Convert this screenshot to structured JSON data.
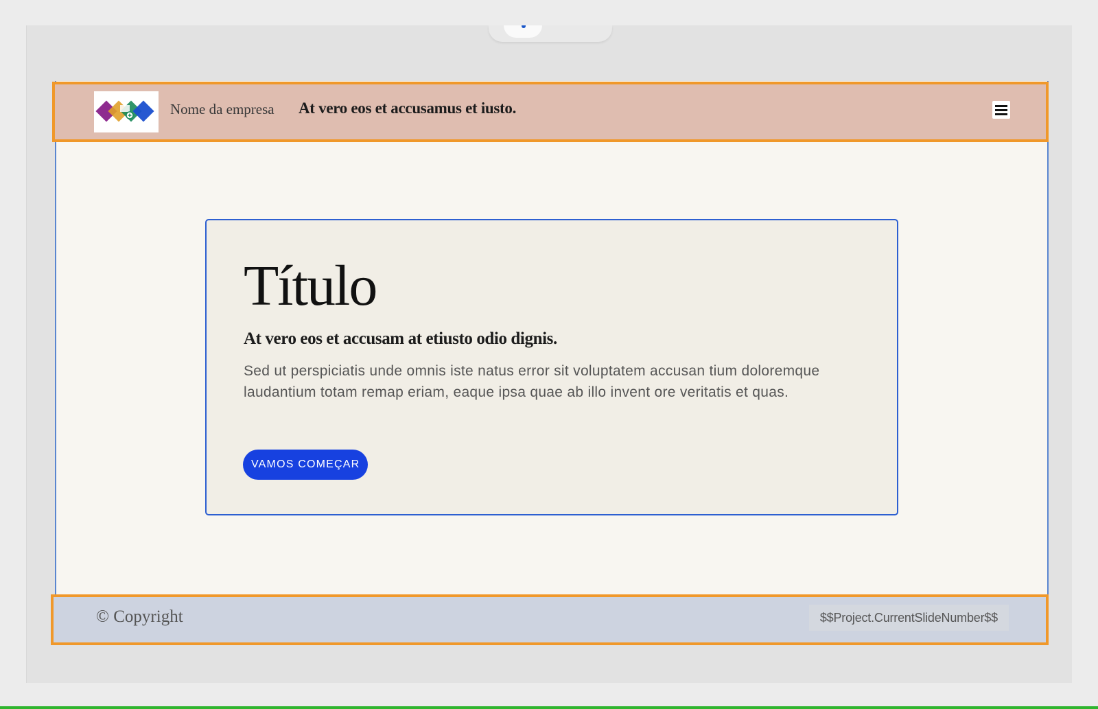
{
  "header": {
    "company_name": "Nome da empresa",
    "tagline": "At vero eos et accusamus et iusto.",
    "menu_icon": "hamburger-menu-icon"
  },
  "hero": {
    "title": "Título",
    "subtitle": "At vero eos et accusam at etiusto odio dignis.",
    "body": "Sed ut perspiciatis unde omnis iste natus error sit voluptatem accusan tium doloremque laudantium totam remap eriam, eaque ipsa quae ab illo invent ore veritatis et quas.",
    "cta_label": "VAMOS COMEÇAR"
  },
  "footer": {
    "copyright": "© Copyright",
    "slide_number": "$$Project.CurrentSlideNumber$$"
  },
  "colors": {
    "header_bg": "#dfbdb0",
    "highlight_border": "#f0982a",
    "accent_blue": "#1741e0",
    "card_border": "#2d5fd1",
    "footer_bg": "#cdd3e0"
  }
}
